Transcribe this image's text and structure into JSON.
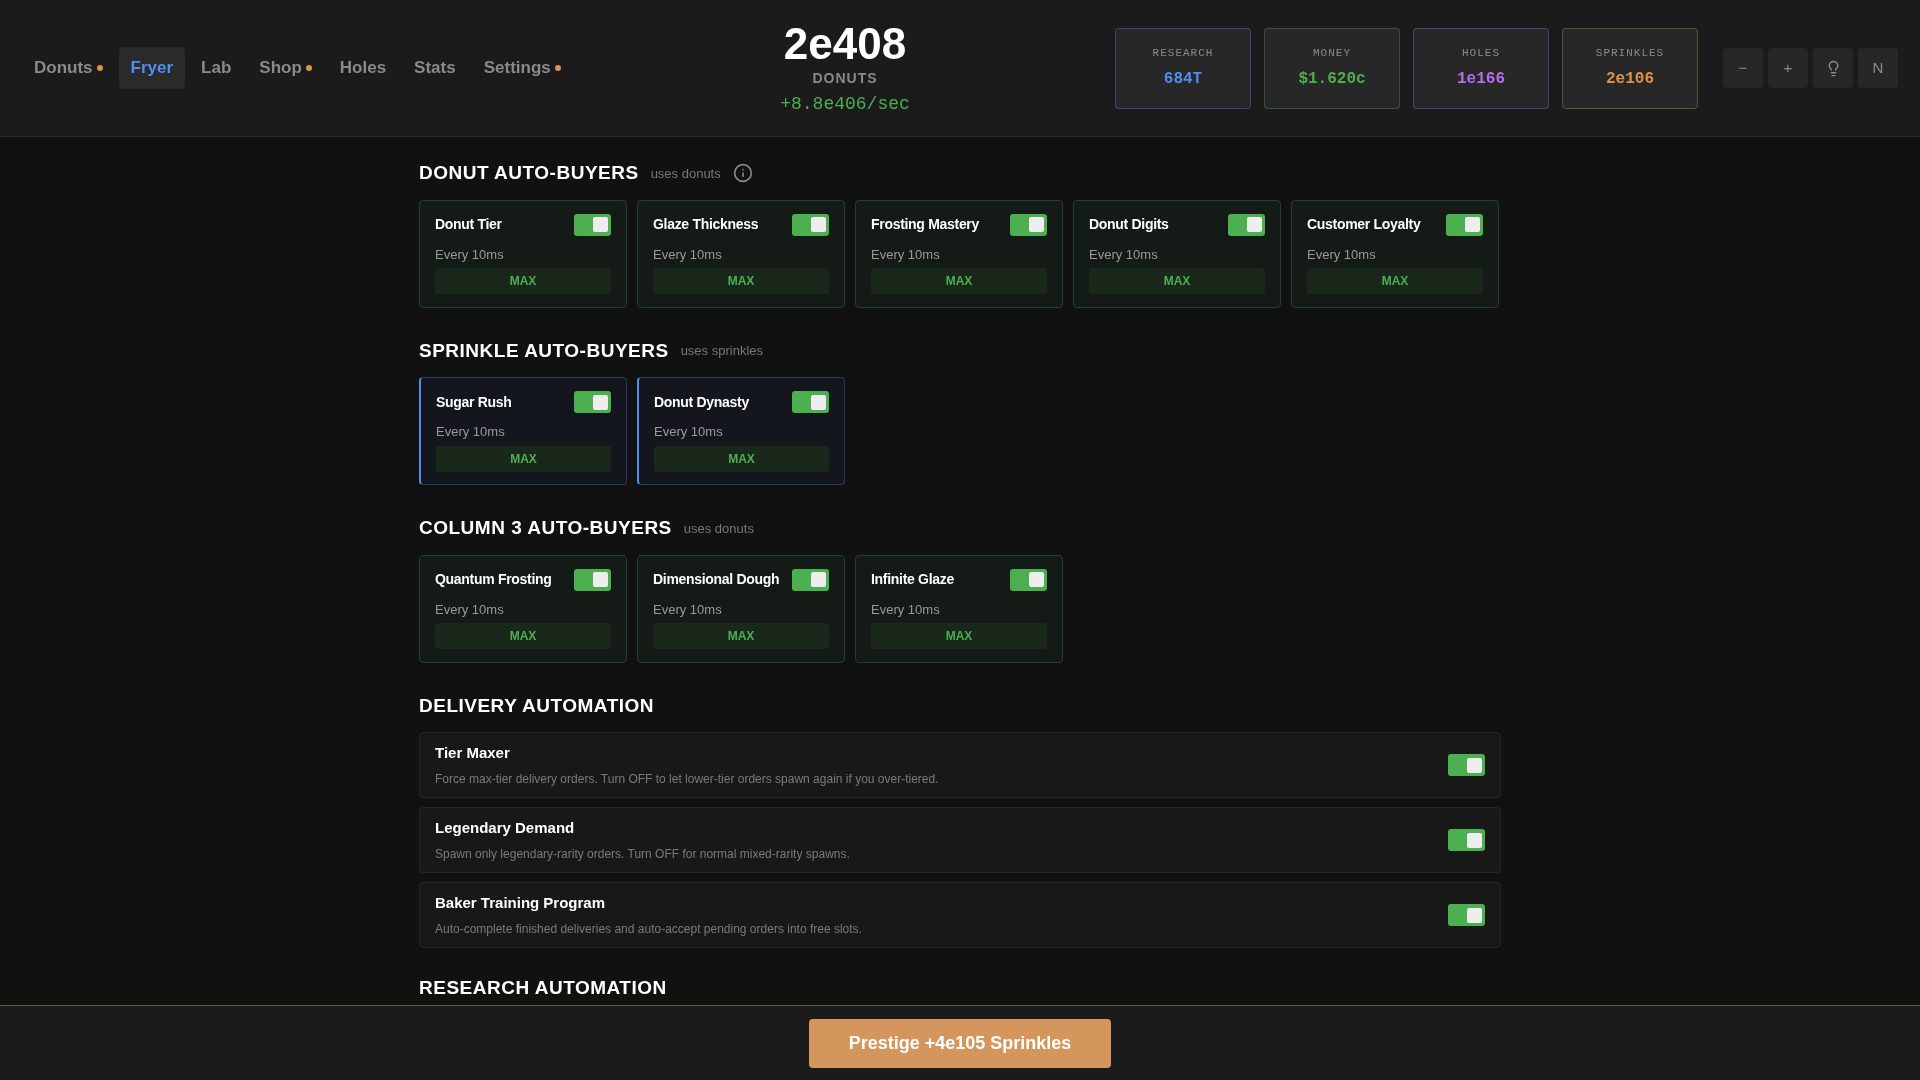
{
  "nav": [
    {
      "label": "Donuts",
      "selected": false,
      "notice": true
    },
    {
      "label": "Fryer",
      "selected": true,
      "notice": false
    },
    {
      "label": "Lab",
      "selected": false,
      "notice": false
    },
    {
      "label": "Shop",
      "selected": false,
      "notice": true
    },
    {
      "label": "Holes",
      "selected": false,
      "notice": false
    },
    {
      "label": "Stats",
      "selected": false,
      "notice": false
    },
    {
      "label": "Settings",
      "selected": false,
      "notice": true
    }
  ],
  "counter": {
    "value": "2e408",
    "label": "DONUTS",
    "rate": "+8.8e406/sec"
  },
  "stats": [
    {
      "label": "RESEARCH",
      "value": "684T",
      "color": "#4d8ff0"
    },
    {
      "label": "MONEY",
      "value": "$1.620c",
      "color": "#4caf50"
    },
    {
      "label": "HOLES",
      "value": "1e166",
      "color": "#b46cf0"
    },
    {
      "label": "SPRINKLES",
      "value": "2e106",
      "color": "#e0904a"
    }
  ],
  "header_buttons": [
    {
      "kind": "text",
      "label": "−"
    },
    {
      "kind": "text",
      "label": "+"
    },
    {
      "kind": "bulb"
    },
    {
      "kind": "text",
      "label": "N"
    }
  ],
  "buyer_sections": [
    {
      "title": "DONUT AUTO-BUYERS",
      "subtitle": "uses donuts",
      "info": true,
      "kind": "donuts",
      "cards": [
        {
          "name": "Donut Tier",
          "on": true,
          "interval": "Every 10ms",
          "action": "MAX"
        },
        {
          "name": "Glaze Thickness",
          "on": true,
          "interval": "Every 10ms",
          "action": "MAX"
        },
        {
          "name": "Frosting Mastery",
          "on": true,
          "interval": "Every 10ms",
          "action": "MAX"
        },
        {
          "name": "Donut Digits",
          "on": true,
          "interval": "Every 10ms",
          "action": "MAX"
        },
        {
          "name": "Customer Loyalty",
          "on": true,
          "interval": "Every 10ms",
          "action": "MAX"
        }
      ]
    },
    {
      "title": "SPRINKLE AUTO-BUYERS",
      "subtitle": "uses sprinkles",
      "info": false,
      "kind": "sprinkles",
      "cards": [
        {
          "name": "Sugar Rush",
          "on": true,
          "interval": "Every 10ms",
          "action": "MAX"
        },
        {
          "name": "Donut Dynasty",
          "on": true,
          "interval": "Every 10ms",
          "action": "MAX"
        }
      ]
    },
    {
      "title": "COLUMN 3 AUTO-BUYERS",
      "subtitle": "uses donuts",
      "info": false,
      "kind": "donuts",
      "cards": [
        {
          "name": "Quantum Frosting",
          "on": true,
          "interval": "Every 10ms",
          "action": "MAX"
        },
        {
          "name": "Dimensional Dough",
          "on": true,
          "interval": "Every 10ms",
          "action": "MAX"
        },
        {
          "name": "Infinite Glaze",
          "on": true,
          "interval": "Every 10ms",
          "action": "MAX"
        }
      ]
    }
  ],
  "delivery": {
    "title": "DELIVERY AUTOMATION",
    "rows": [
      {
        "name": "Tier Maxer",
        "description": "Force max-tier delivery orders. Turn OFF to let lower-tier orders spawn again if you over-tiered.",
        "on": true
      },
      {
        "name": "Legendary Demand",
        "description": "Spawn only legendary-rarity orders. Turn OFF for normal mixed-rarity spawns.",
        "on": true
      },
      {
        "name": "Baker Training Program",
        "description": "Auto-complete finished deliveries and auto-accept pending orders into free slots.",
        "on": true
      }
    ]
  },
  "research": {
    "title": "RESEARCH AUTOMATION"
  },
  "prestige_button": "Prestige +4e105 Sprinkles"
}
